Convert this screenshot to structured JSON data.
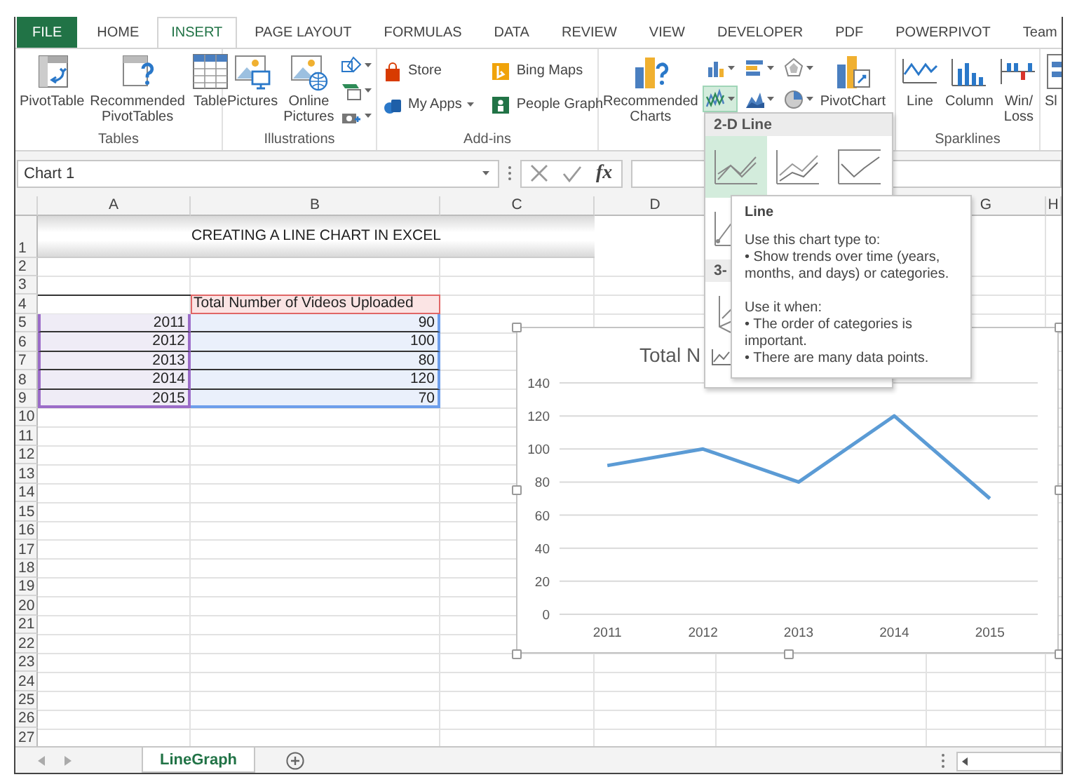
{
  "ribbon_tabs": [
    {
      "label": "FILE",
      "kind": "file",
      "selected": false
    },
    {
      "label": "HOME",
      "kind": "tab",
      "selected": false
    },
    {
      "label": "INSERT",
      "kind": "tab",
      "selected": true
    },
    {
      "label": "PAGE LAYOUT",
      "kind": "tab",
      "selected": false
    },
    {
      "label": "FORMULAS",
      "kind": "tab",
      "selected": false
    },
    {
      "label": "DATA",
      "kind": "tab",
      "selected": false
    },
    {
      "label": "REVIEW",
      "kind": "tab",
      "selected": false
    },
    {
      "label": "VIEW",
      "kind": "tab",
      "selected": false
    },
    {
      "label": "DEVELOPER",
      "kind": "tab",
      "selected": false
    },
    {
      "label": "PDF",
      "kind": "tab",
      "selected": false
    },
    {
      "label": "POWERPIVOT",
      "kind": "tab",
      "selected": false
    },
    {
      "label": "Team",
      "kind": "tab",
      "selected": false
    }
  ],
  "ribbon": {
    "groups": [
      {
        "label": "Tables",
        "items": [
          {
            "kind": "large",
            "label": "PivotTable"
          },
          {
            "kind": "large",
            "label": "Recommended PivotTables"
          },
          {
            "kind": "large",
            "label": "Table"
          }
        ]
      },
      {
        "label": "Illustrations",
        "items": [
          {
            "kind": "large",
            "label": "Pictures"
          },
          {
            "kind": "large",
            "label": "Online Pictures"
          },
          {
            "kind": "icons"
          }
        ]
      },
      {
        "label": "Add-ins",
        "items": [
          {
            "kind": "small",
            "label": "Store",
            "dropdown": false
          },
          {
            "kind": "small",
            "label": "My Apps",
            "dropdown": true
          },
          {
            "kind": "small",
            "label": "Bing Maps",
            "dropdown": false
          },
          {
            "kind": "small",
            "label": "People Graph",
            "dropdown": false
          }
        ]
      },
      {
        "items": [
          {
            "kind": "large",
            "label": "Recommended Charts"
          },
          {
            "kind": "chart_grid",
            "buttons": [
              {
                "expanded": false
              },
              {
                "expanded": false
              },
              {
                "expanded": false
              },
              {
                "expanded": true
              },
              {
                "expanded": false
              },
              {
                "expanded": false
              }
            ]
          },
          {
            "kind": "large",
            "label": "PivotChart"
          }
        ]
      },
      {
        "label": "Sparklines",
        "items": [
          {
            "kind": "large",
            "label": "Line"
          },
          {
            "kind": "large",
            "label": "Column"
          },
          {
            "kind": "large",
            "label": "Win/ Loss"
          }
        ]
      },
      {
        "items": [
          {
            "kind": "large",
            "label": "Sl"
          }
        ]
      }
    ]
  },
  "formula_bar": {
    "name_box": "Chart 1",
    "function_button": "fx"
  },
  "sheet": {
    "columns": [
      "A",
      "B",
      "C",
      "D",
      "G",
      "H"
    ],
    "row_numbers": [
      "1",
      "2",
      "3",
      "4",
      "5",
      "6",
      "7",
      "8",
      "9",
      "10",
      "11",
      "12",
      "13",
      "14",
      "15",
      "16",
      "17",
      "18",
      "19",
      "20",
      "21",
      "22",
      "23",
      "24",
      "25",
      "26",
      "27"
    ],
    "title_cell": "CREATING A LINE CHART IN EXCEL",
    "header_cell": "Total Number of Videos Uploaded",
    "data_rows": [
      {
        "year": "2011",
        "value": "90"
      },
      {
        "year": "2012",
        "value": "100"
      },
      {
        "year": "2013",
        "value": "80"
      },
      {
        "year": "2014",
        "value": "120"
      },
      {
        "year": "2015",
        "value": "70"
      }
    ]
  },
  "chart": {
    "title": "Total N",
    "chart_data": {
      "type": "line",
      "categories": [
        "2011",
        "2012",
        "2013",
        "2014",
        "2015"
      ],
      "series": [
        {
          "color": "#5b9bd5",
          "values": [
            90,
            100,
            80,
            120,
            70
          ]
        }
      ],
      "ylim": [
        0,
        140
      ],
      "yticks": [
        0,
        20,
        40,
        60,
        80,
        100,
        120,
        140
      ],
      "grid": true
    }
  },
  "chart_gallery": {
    "sections": [
      {
        "label": "2-D Line"
      },
      {
        "label": "3-"
      }
    ],
    "options": [
      {
        "selected": true
      },
      {
        "selected": false
      },
      {
        "selected": false
      }
    ]
  },
  "tooltip": {
    "title": "Line",
    "paragraphs": [
      {
        "heading": "Use this chart type to:",
        "bullets": [
          "• Show trends over time (years, months, and days) or categories."
        ]
      },
      {
        "heading": "Use it when:",
        "bullets": [
          "• The order of categories is important.",
          "• There are many data points."
        ]
      }
    ]
  },
  "sheet_tabs": [
    {
      "label": "LineGraph",
      "selected": true
    }
  ]
}
